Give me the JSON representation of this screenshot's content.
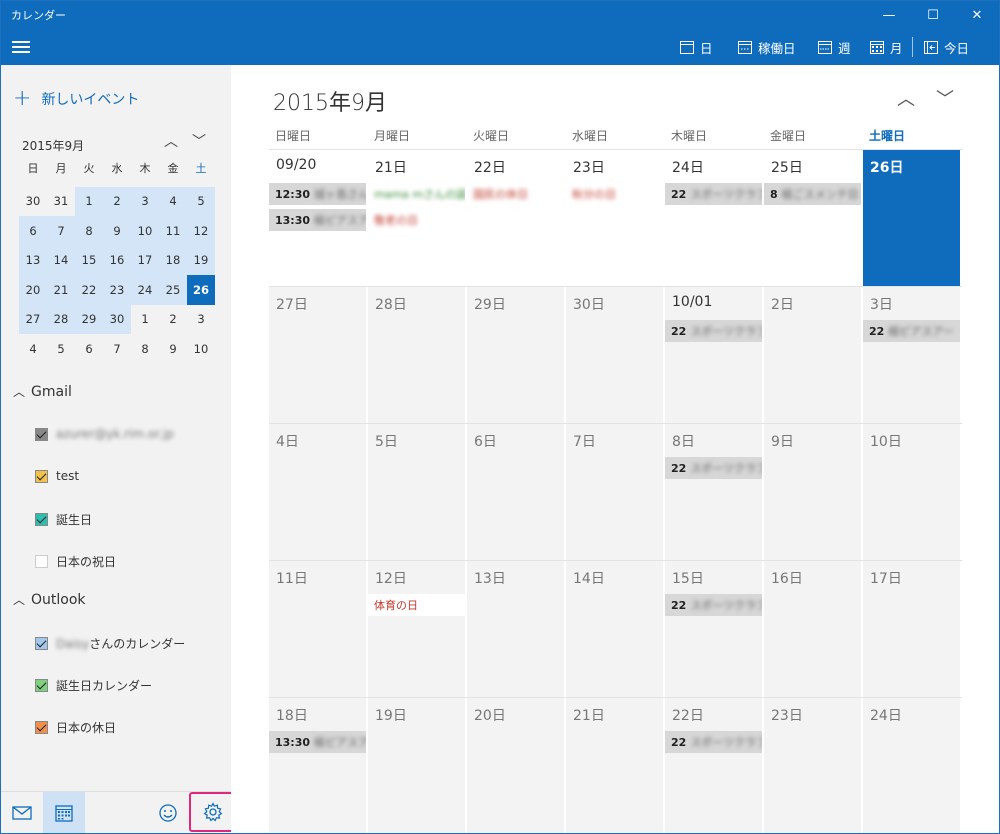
{
  "app": {
    "title": "カレンダー"
  },
  "window_controls": {
    "minimize": "—",
    "maximize": "☐",
    "close": "✕"
  },
  "toolbar": {
    "views": [
      "日",
      "稼働日",
      "週",
      "月",
      "今日"
    ]
  },
  "sidebar": {
    "new_event": "新しいイベント",
    "mini_month": {
      "title": "2015年9月",
      "weekdays": [
        "日",
        "月",
        "火",
        "水",
        "木",
        "金",
        "土"
      ],
      "weeks": [
        [
          "30",
          "31",
          "1",
          "2",
          "3",
          "4",
          "5"
        ],
        [
          "6",
          "7",
          "8",
          "9",
          "10",
          "11",
          "12"
        ],
        [
          "13",
          "14",
          "15",
          "16",
          "17",
          "18",
          "19"
        ],
        [
          "20",
          "21",
          "22",
          "23",
          "24",
          "25",
          "26"
        ],
        [
          "27",
          "28",
          "29",
          "30",
          "1",
          "2",
          "3"
        ],
        [
          "4",
          "5",
          "6",
          "7",
          "8",
          "9",
          "10"
        ]
      ],
      "selected_day": "26"
    },
    "accounts": [
      {
        "name": "Gmail",
        "calendars": [
          {
            "label": "azurer@yk.rim.or.jp",
            "color": "#888888",
            "checked": true
          },
          {
            "label": "test",
            "color": "#f0c24b",
            "checked": true
          },
          {
            "label": "誕生日",
            "color": "#2bbfb1",
            "checked": true
          },
          {
            "label": "日本の祝日",
            "color": "#ffffff",
            "checked": false
          }
        ]
      },
      {
        "name": "Outlook",
        "calendars": [
          {
            "label_blur": "Daisy",
            "label": "さんのカレンダー",
            "color": "#a4c8ec",
            "checked": true
          },
          {
            "label": "誕生日カレンダー",
            "color": "#7fd07f",
            "checked": true
          },
          {
            "label": "日本の休日",
            "color": "#f28f4d",
            "checked": true
          }
        ]
      }
    ]
  },
  "main": {
    "title": "2015年9月",
    "day_names": [
      "日曜日",
      "月曜日",
      "火曜日",
      "水曜日",
      "木曜日",
      "金曜日",
      "土曜日"
    ],
    "weeks": [
      [
        "09/20",
        "21日",
        "22日",
        "23日",
        "24日",
        "25日",
        "26日"
      ],
      [
        "27日",
        "28日",
        "29日",
        "30日",
        "10/01",
        "2日",
        "3日"
      ],
      [
        "4日",
        "5日",
        "6日",
        "7日",
        "8日",
        "9日",
        "10日"
      ],
      [
        "11日",
        "12日",
        "13日",
        "14日",
        "15日",
        "16日",
        "17日"
      ],
      [
        "18日",
        "19日",
        "20日",
        "21日",
        "22日",
        "23日",
        "24日"
      ]
    ],
    "events": {
      "e1": {
        "time": "12:30",
        "title": "城ヶ島さんと"
      },
      "e2": {
        "time": "13:30",
        "title": "極ピアスアー"
      },
      "e3": {
        "title": "mama mさんの誕"
      },
      "e4": {
        "title": "敬老の日"
      },
      "e5": {
        "title": "国民の休日"
      },
      "e6": {
        "title": "秋分の日"
      },
      "e7": {
        "time": "22",
        "title": "スポーツクラブ"
      },
      "e8": {
        "time": "8",
        "title": "極ごスメンテ日"
      },
      "e9": {
        "time": "22",
        "title": "スポーツクラブ"
      },
      "e10": {
        "time": "22",
        "title": "極ピアスアー"
      },
      "e11": {
        "time": "22",
        "title": "スポーツクラブ"
      },
      "e12": {
        "title": "体育の日"
      },
      "e13": {
        "time": "22",
        "title": "スポーツクラブ"
      },
      "e14": {
        "time": "13:30",
        "title": "極ピアスアー"
      },
      "e15": {
        "time": "22",
        "title": "スポーツクラブ"
      }
    }
  }
}
